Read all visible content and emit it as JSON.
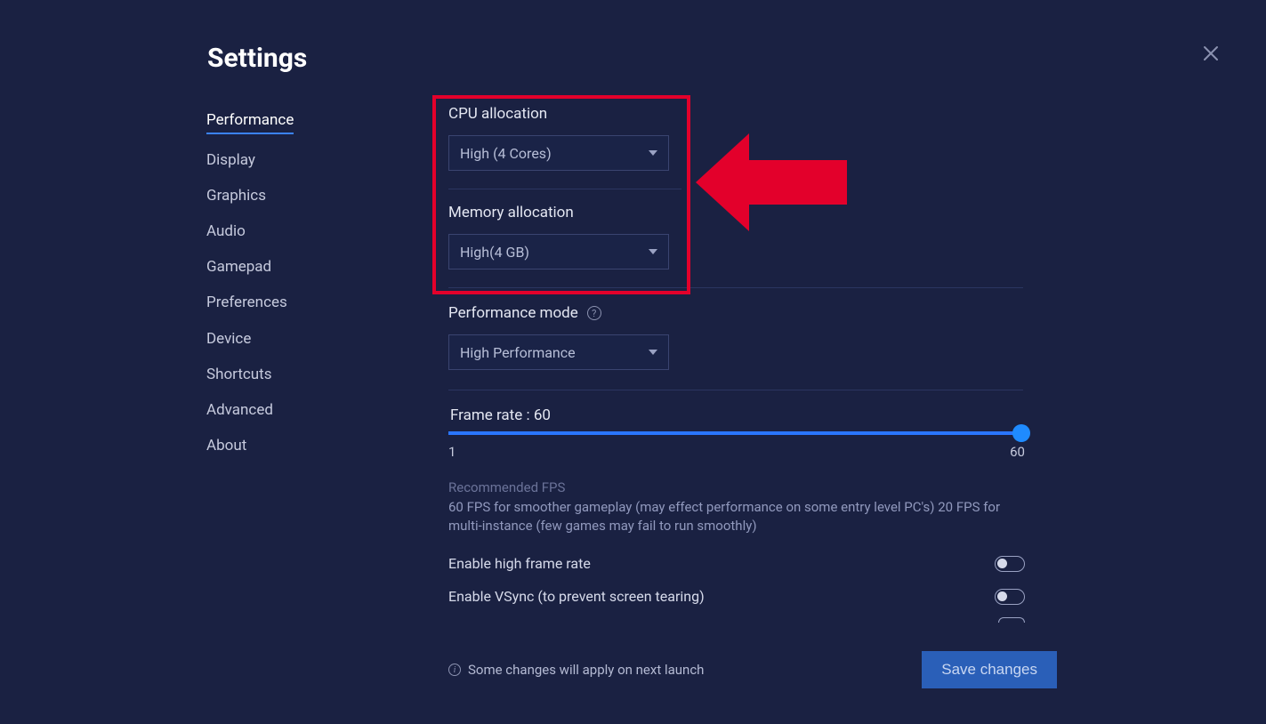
{
  "title": "Settings",
  "sidebar": {
    "items": [
      {
        "label": "Performance",
        "active": true
      },
      {
        "label": "Display"
      },
      {
        "label": "Graphics"
      },
      {
        "label": "Audio"
      },
      {
        "label": "Gamepad"
      },
      {
        "label": "Preferences"
      },
      {
        "label": "Device"
      },
      {
        "label": "Shortcuts"
      },
      {
        "label": "Advanced"
      },
      {
        "label": "About"
      }
    ]
  },
  "cpu": {
    "label": "CPU allocation",
    "value": "High (4 Cores)"
  },
  "memory": {
    "label": "Memory allocation",
    "value": "High(4 GB)"
  },
  "perf_mode": {
    "label": "Performance mode",
    "value": "High Performance"
  },
  "frame_rate": {
    "label_prefix": "Frame rate : ",
    "value": "60",
    "min": "1",
    "max": "60"
  },
  "recommended": {
    "title": "Recommended FPS",
    "desc": "60 FPS for smoother gameplay (may effect performance on some entry level PC's) 20 FPS for multi-instance (few games may fail to run smoothly)"
  },
  "toggles": {
    "high_fps": "Enable high frame rate",
    "vsync": "Enable VSync (to prevent screen tearing)"
  },
  "footer": {
    "note": "Some changes will apply on next launch",
    "save": "Save changes"
  },
  "annotation": {
    "arrow_color": "#e3002b"
  }
}
